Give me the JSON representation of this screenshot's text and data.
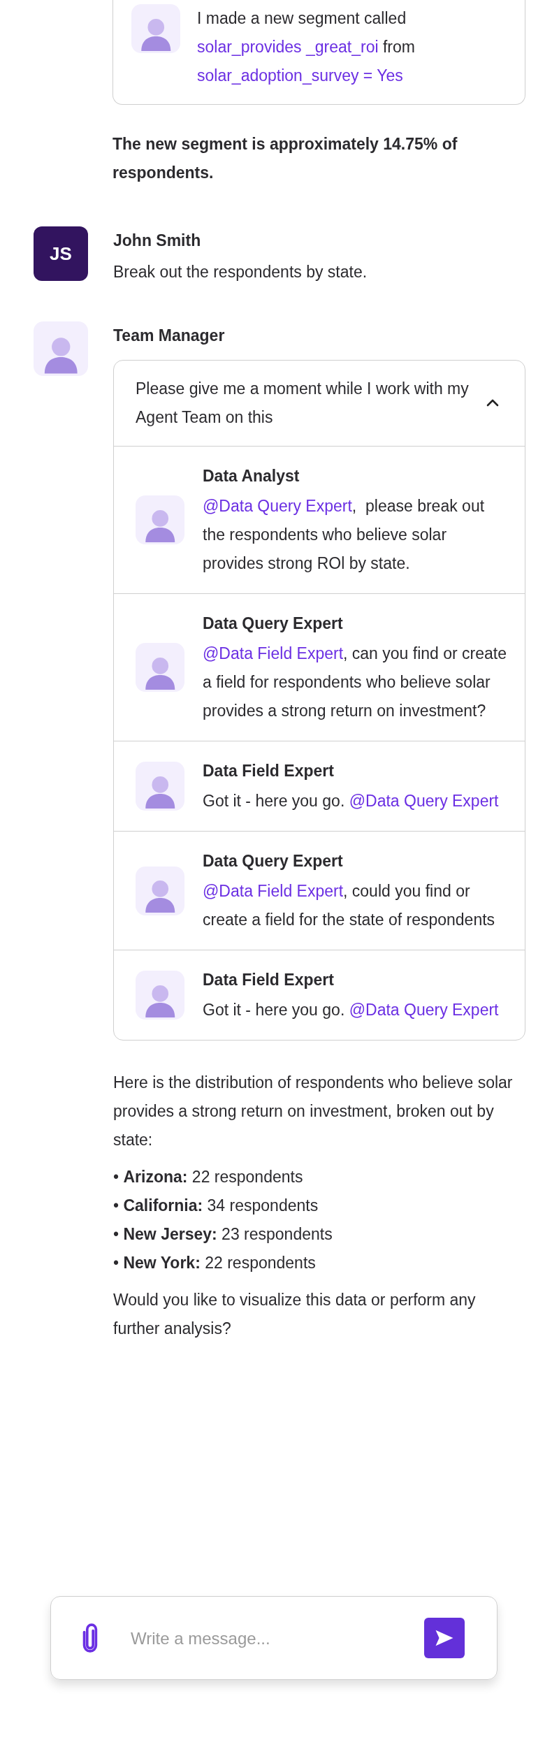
{
  "top_card": {
    "message": [
      {
        "kind": "text",
        "text": "I made a new segment called "
      },
      {
        "kind": "mention",
        "text": "solar_provides _great_roi"
      },
      {
        "kind": "text",
        "text": " from "
      },
      {
        "kind": "mention",
        "text": "solar_adoption_survey = Yes"
      }
    ]
  },
  "summary": "The new segment is approximately 14.75% of respondents.",
  "user_message": {
    "initials": "JS",
    "sender": "John Smith",
    "text": "Break out the respondents by state."
  },
  "manager_message": {
    "sender": "Team Manager",
    "thread": {
      "header": "Please give me a moment while I work with my Agent Team on this",
      "expanded": true,
      "entries": [
        {
          "sender": "Data Analyst",
          "parts": [
            {
              "kind": "mention",
              "text": "@Data Query Expert"
            },
            {
              "kind": "text",
              "text": ",  please break out the respondents who believe solar provides strong ROl by state."
            }
          ]
        },
        {
          "sender": "Data Query Expert",
          "parts": [
            {
              "kind": "mention",
              "text": "@Data Field Expert"
            },
            {
              "kind": "text",
              "text": ", can you find or create a field for respondents who believe solar provides a strong return on investment?"
            }
          ]
        },
        {
          "sender": "Data Field Expert",
          "parts": [
            {
              "kind": "text",
              "text": "Got it - here you go. "
            },
            {
              "kind": "mention",
              "text": "@Data Query Expert"
            }
          ]
        },
        {
          "sender": "Data Query Expert",
          "parts": [
            {
              "kind": "mention",
              "text": "@Data Field Expert"
            },
            {
              "kind": "text",
              "text": ", could you find or create a field for the state of respondents"
            }
          ]
        },
        {
          "sender": "Data Field Expert",
          "parts": [
            {
              "kind": "text",
              "text": "Got it - here you go. "
            },
            {
              "kind": "mention",
              "text": "@Data Query Expert"
            }
          ]
        }
      ]
    },
    "reply": {
      "intro": "Here is the distribution of respondents who believe solar provides a strong return on investment, broken out by state:",
      "items": [
        {
          "bullet": "•",
          "label": "Arizona:",
          "value": "22 respondents"
        },
        {
          "bullet": "•",
          "label": "California:",
          "value": "34 respondents"
        },
        {
          "bullet": "•",
          "label": "New Jersey:",
          "value": "23 respondents"
        },
        {
          "bullet": "•",
          "label": "New York:",
          "value": "22 respondents"
        }
      ],
      "closing": "Would you like to visualize this data or perform any further analysis?"
    }
  },
  "composer": {
    "placeholder": "Write a message..."
  }
}
